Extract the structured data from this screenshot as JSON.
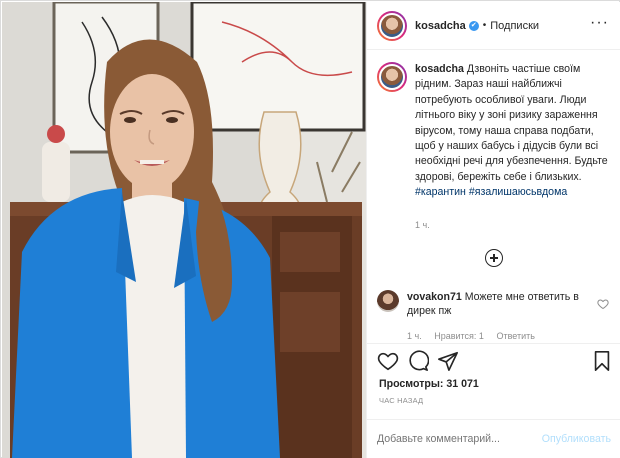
{
  "post": {
    "username": "kosadcha",
    "verified_badge": "✔",
    "separator": "•",
    "follow_label": "Подписки",
    "more_icon": "···"
  },
  "caption": {
    "username": "kosadcha",
    "text": "Дзвоніть частіше своїм рідним. Зараз наші найближчі потребують особливої уваги. Люди літнього віку у зоні ризику зараження вірусом, тому наша справа подбати, щоб у наших бабусь і дідусів були всі необхідні речі для убезпечення. Будьте здорові, бережіть себе і близьких.",
    "hashtag1": "#карантин",
    "hashtag2": "#язалишаюсьвдома",
    "time": "1 ч."
  },
  "comment": {
    "username": "vovakon71",
    "text": "Можете мне ответить в дирек пж",
    "time": "1 ч.",
    "likes": "Нравится: 1",
    "reply": "Ответить"
  },
  "stats": {
    "views_label": "Просмотры:",
    "views_count": "31 071",
    "ago": "ЧАС НАЗАД"
  },
  "add_comment": {
    "placeholder": "Добавьте комментарий...",
    "publish_label": "Опубликовать"
  },
  "colors": {
    "link": "#003569",
    "verified": "#3897f0",
    "publish_disabled": "#b2dffc",
    "border": "#efefef"
  }
}
